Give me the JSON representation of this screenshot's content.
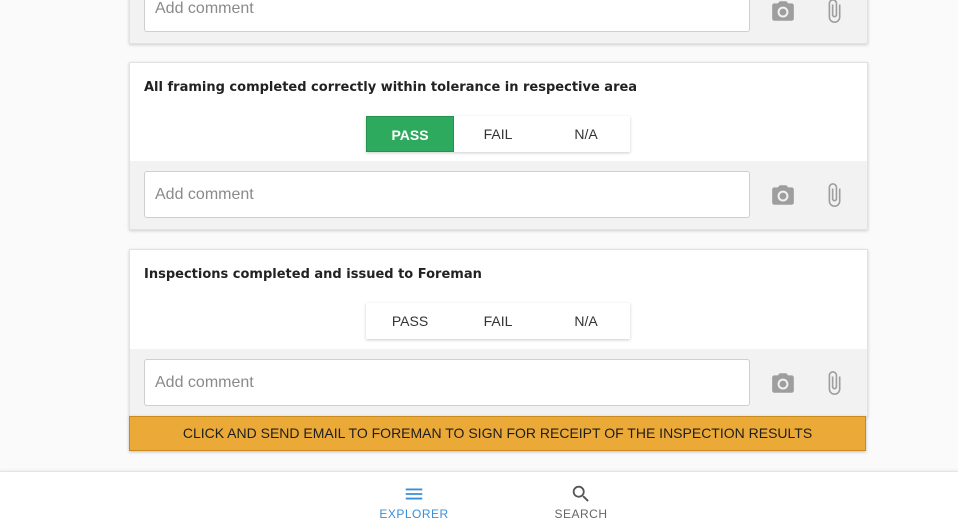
{
  "items": [
    {
      "comment_placeholder": "Add comment"
    },
    {
      "title": "All framing completed correctly within tolerance in respective area",
      "options": [
        "PASS",
        "FAIL",
        "N/A"
      ],
      "selected": "PASS",
      "comment_placeholder": "Add comment"
    },
    {
      "title": "Inspections completed and issued to Foreman",
      "options": [
        "PASS",
        "FAIL",
        "N/A"
      ],
      "selected": null,
      "comment_placeholder": "Add comment"
    }
  ],
  "email_button_label": "CLICK AND SEND EMAIL TO FOREMAN TO SIGN FOR RECEIPT OF THE INSPECTION RESULTS",
  "bottom_nav": [
    {
      "label": "EXPLORER",
      "icon": "menu-icon",
      "active": true
    },
    {
      "label": "SEARCH",
      "icon": "search-icon",
      "active": false
    }
  ],
  "colors": {
    "pass_active": "#2eaa5e",
    "email_button": "#eba937",
    "nav_active": "#3a8fd6",
    "nav_inactive": "#666666",
    "icon_grey": "#9e9e9e"
  }
}
